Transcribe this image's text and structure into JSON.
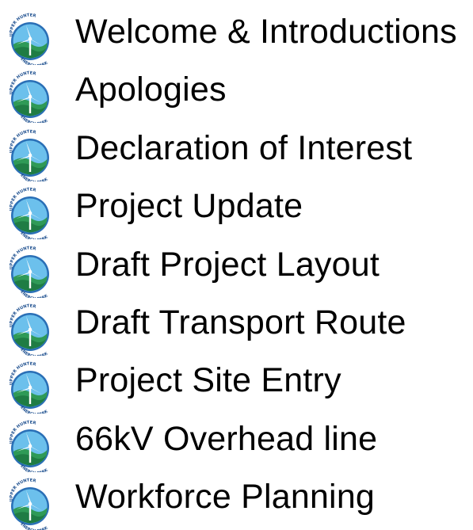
{
  "logo": {
    "top_text": "UPPER HUNTER",
    "bottom_text": "ENERGY PARK",
    "icon": "upper-hunter-energy-park-logo",
    "colors": {
      "sky": "#5fb6e6",
      "ring": "#2a6fb6",
      "land": "#2f9a57",
      "turbine": "#ffffff",
      "text": "#1d4f8f"
    }
  },
  "agenda": {
    "items": [
      {
        "label": "Welcome & Introductions"
      },
      {
        "label": "Apologies"
      },
      {
        "label": "Declaration of Interest"
      },
      {
        "label": "Project Update"
      },
      {
        "label": "Draft Project Layout"
      },
      {
        "label": "Draft Transport Route"
      },
      {
        "label": "Project Site Entry"
      },
      {
        "label": "66kV Overhead line"
      },
      {
        "label": "Workforce Planning"
      }
    ]
  }
}
